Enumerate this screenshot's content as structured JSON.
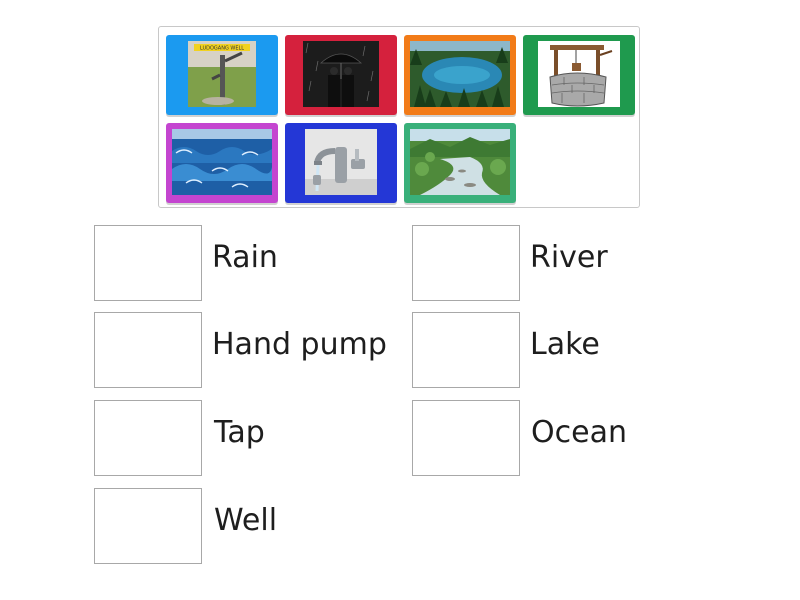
{
  "tiles": [
    {
      "name": "hand-pump-picture-tile",
      "frame_color": "#1b9af0",
      "icon": "hand-pump-picture",
      "sign_text": "LUDOGANG WELL"
    },
    {
      "name": "rain-picture-tile",
      "frame_color": "#d5213d",
      "icon": "people-with-umbrella-in-rain-picture"
    },
    {
      "name": "lake-picture-tile",
      "frame_color": "#f27b18",
      "icon": "forest-lake-picture"
    },
    {
      "name": "well-picture-tile",
      "frame_color": "#1f9a4e",
      "icon": "stone-well-picture"
    },
    {
      "name": "ocean-picture-tile",
      "frame_color": "#c445d0",
      "icon": "ocean-waves-picture"
    },
    {
      "name": "tap-picture-tile",
      "frame_color": "#2437d6",
      "icon": "water-tap-picture"
    },
    {
      "name": "river-picture-tile",
      "frame_color": "#39b07a",
      "icon": "mountain-river-picture"
    }
  ],
  "targets": {
    "left": [
      "Rain",
      "Hand pump",
      "Tap",
      "Well"
    ],
    "right": [
      "River",
      "Lake",
      "Ocean"
    ]
  }
}
